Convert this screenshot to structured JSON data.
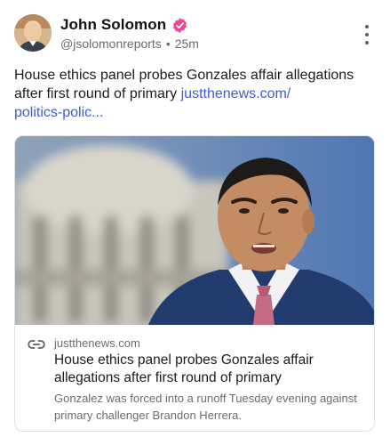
{
  "author": {
    "display_name": "John Solomon",
    "handle": "@jsolomonreports",
    "separator": "•",
    "time_ago": "25m",
    "verified_color": "#ec4899"
  },
  "post": {
    "text": "House ethics panel probes Gonzales affair allegations after first round of primary",
    "link_text": "justthenews.com/\npolitics-polic..."
  },
  "card": {
    "domain": "justthenews.com",
    "title": "House ethics panel probes Gonzales affair allegations after first round of primary",
    "description": "Gonzalez was forced into a runoff Tuesday evening against primary challenger Brandon Herrera."
  },
  "icons": {
    "verified": "verified-badge-icon",
    "more": "more-vertical-icon",
    "link": "link-icon"
  },
  "colors": {
    "link_blue": "#3e5bd8",
    "secondary_text": "#6b6b73"
  }
}
